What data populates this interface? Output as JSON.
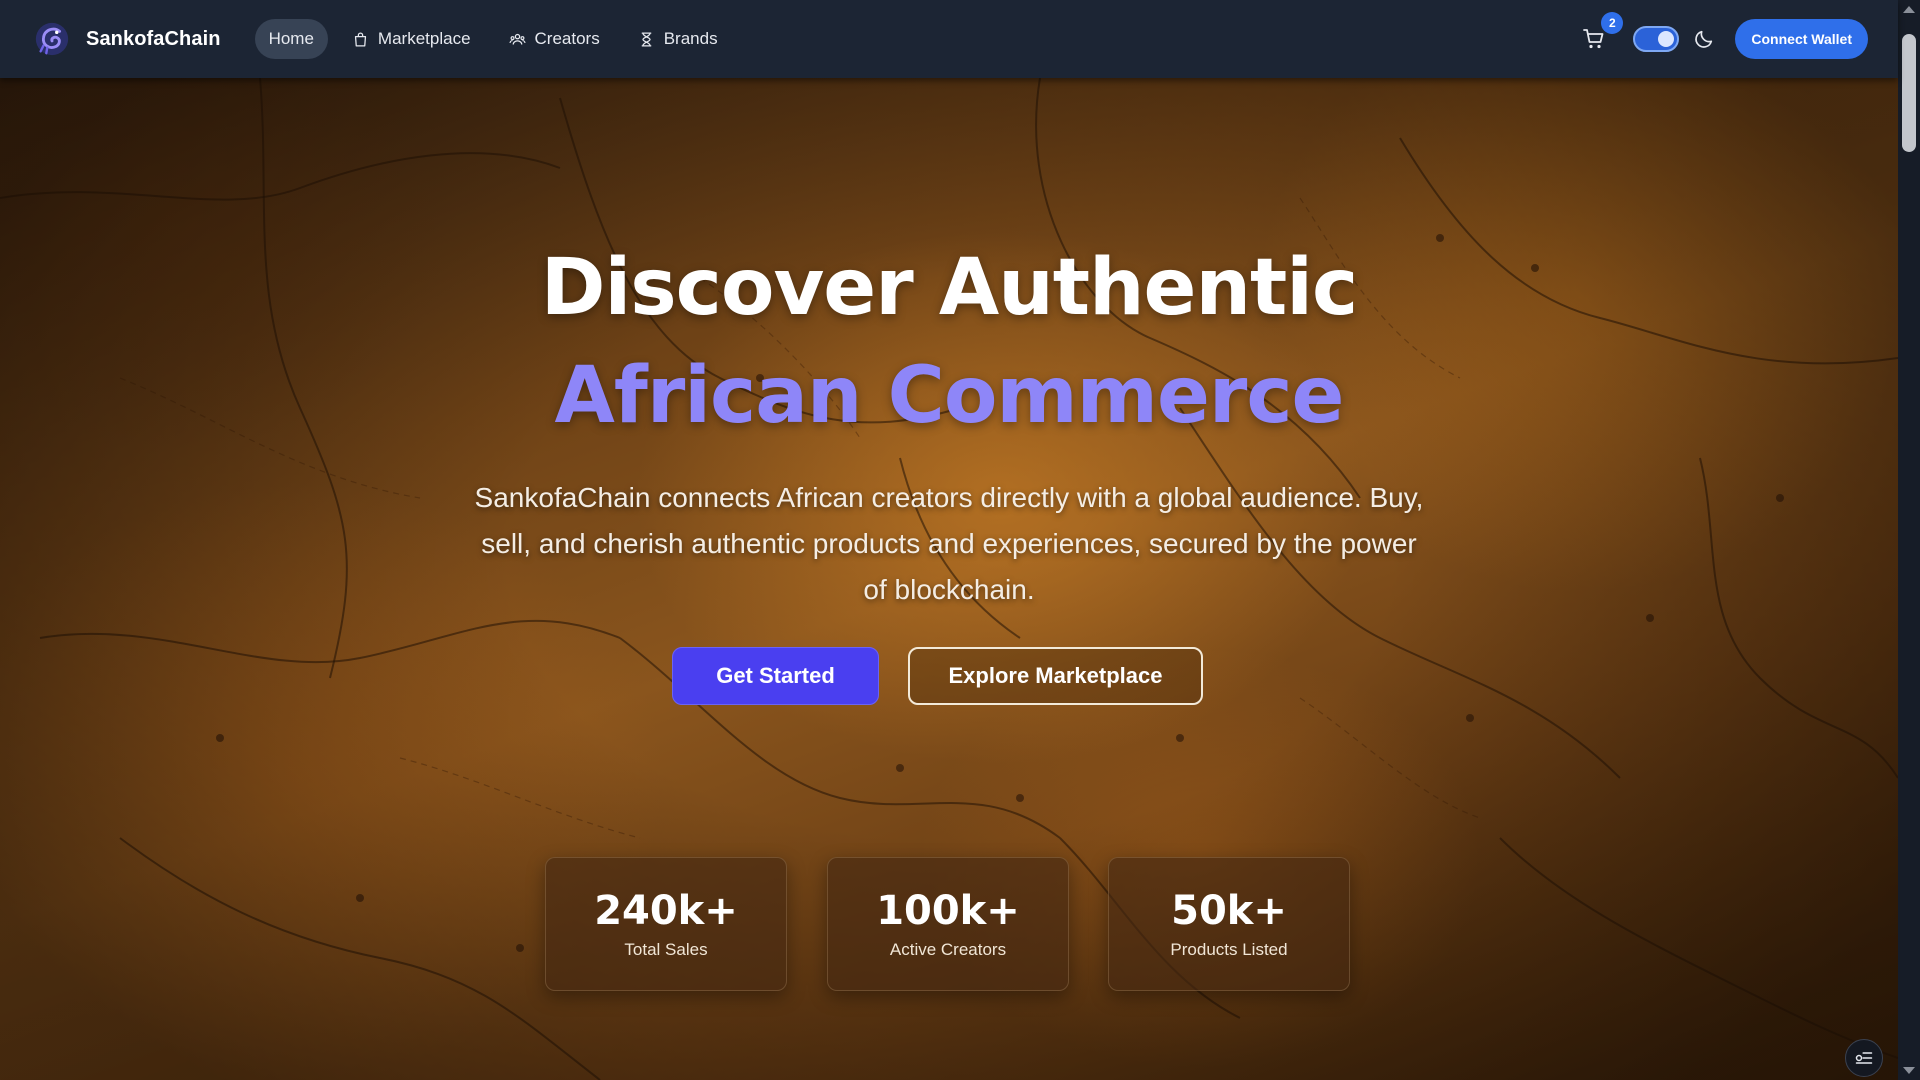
{
  "app": {
    "brand_name": "SankofaChain",
    "logo_icon": "sankofa-bird-logo"
  },
  "nav": {
    "items": [
      {
        "label": "Home",
        "active": true,
        "icon": ""
      },
      {
        "label": "Marketplace",
        "active": false,
        "icon": "shopping-bag-icon"
      },
      {
        "label": "Creators",
        "active": false,
        "icon": "users-icon"
      },
      {
        "label": "Brands",
        "active": false,
        "icon": "hourglass-icon"
      }
    ]
  },
  "header_actions": {
    "cart_count": "2",
    "theme_toggle_on": true,
    "connect_wallet_label": "Connect Wallet"
  },
  "hero": {
    "title_line1": "Discover Authentic",
    "title_line2": "African Commerce",
    "subtitle": "SankofaChain connects African creators directly with a global audience. Buy, sell, and cherish authentic products and experiences, secured by the power of blockchain.",
    "primary_cta": "Get Started",
    "secondary_cta": "Explore Marketplace"
  },
  "stats": [
    {
      "value": "240k+",
      "label": "Total Sales"
    },
    {
      "value": "100k+",
      "label": "Active Creators"
    },
    {
      "value": "50k+",
      "label": "Products Listed"
    }
  ],
  "colors": {
    "navbar_bg": "#1c2534",
    "accent_blue": "#2f6fea",
    "title_purple": "#8e86f8",
    "primary_button": "#4a3ff0"
  }
}
